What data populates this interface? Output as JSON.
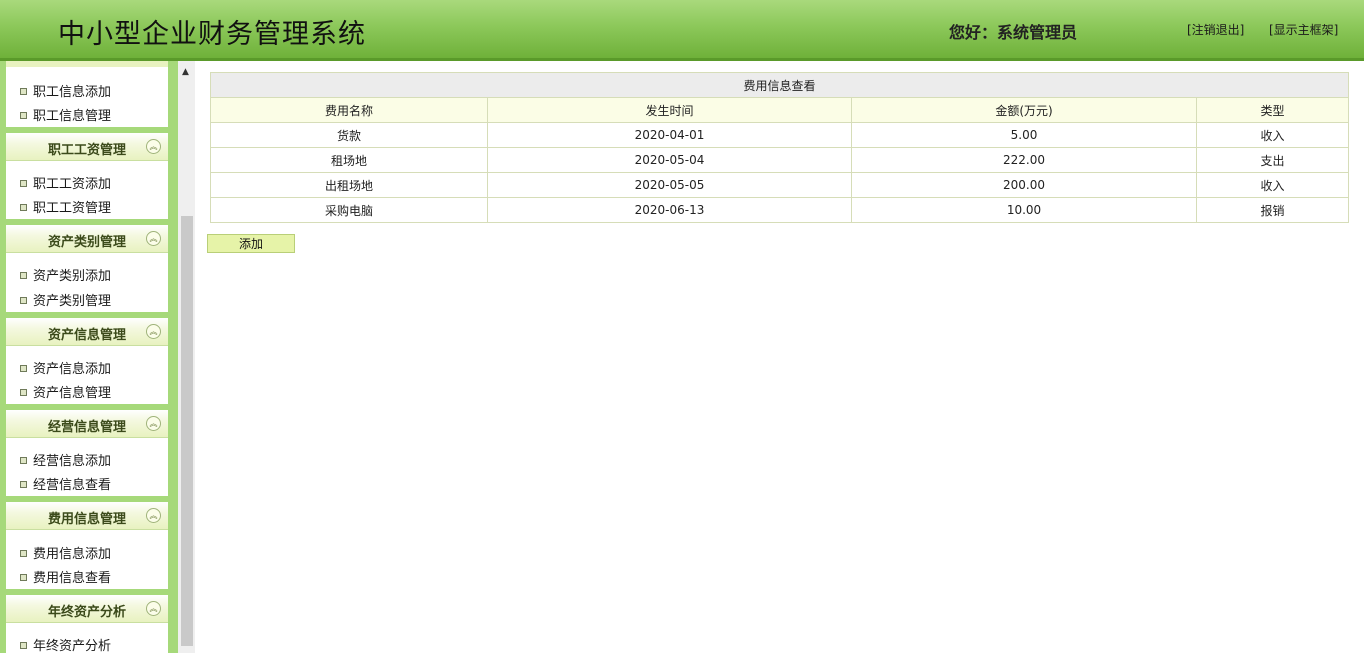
{
  "header": {
    "title": "中小型企业财务管理系统",
    "greeting": "您好：系统管理员",
    "logout_label": "[注销退出]",
    "home_label": "[显示主框架]",
    "bg_color": "#8cc85a"
  },
  "sidebar": {
    "partial_top_items": [
      "职工信息添加",
      "职工信息管理"
    ],
    "sections": [
      {
        "title": "职工工资管理",
        "items": [
          "职工工资添加",
          "职工工资管理"
        ]
      },
      {
        "title": "资产类别管理",
        "items": [
          "资产类别添加",
          "资产类别管理"
        ]
      },
      {
        "title": "资产信息管理",
        "items": [
          "资产信息添加",
          "资产信息管理"
        ]
      },
      {
        "title": "经营信息管理",
        "items": [
          "经营信息添加",
          "经营信息查看"
        ]
      },
      {
        "title": "费用信息管理",
        "items": [
          "费用信息添加",
          "费用信息查看"
        ]
      },
      {
        "title": "年终资产分析",
        "items": [
          "年终资产分析"
        ]
      }
    ],
    "collapse_icon": "double-chevron-up-icon"
  },
  "main": {
    "caption": "费用信息查看",
    "columns": [
      "费用名称",
      "发生时间",
      "金额(万元)",
      "类型"
    ],
    "rows": [
      [
        "货款",
        "2020-04-01",
        "5.00",
        "收入"
      ],
      [
        "租场地",
        "2020-05-04",
        "222.00",
        "支出"
      ],
      [
        "出租场地",
        "2020-05-05",
        "200.00",
        "收入"
      ],
      [
        "采购电脑",
        "2020-06-13",
        "10.00",
        "报销"
      ]
    ],
    "add_label": "添加"
  }
}
